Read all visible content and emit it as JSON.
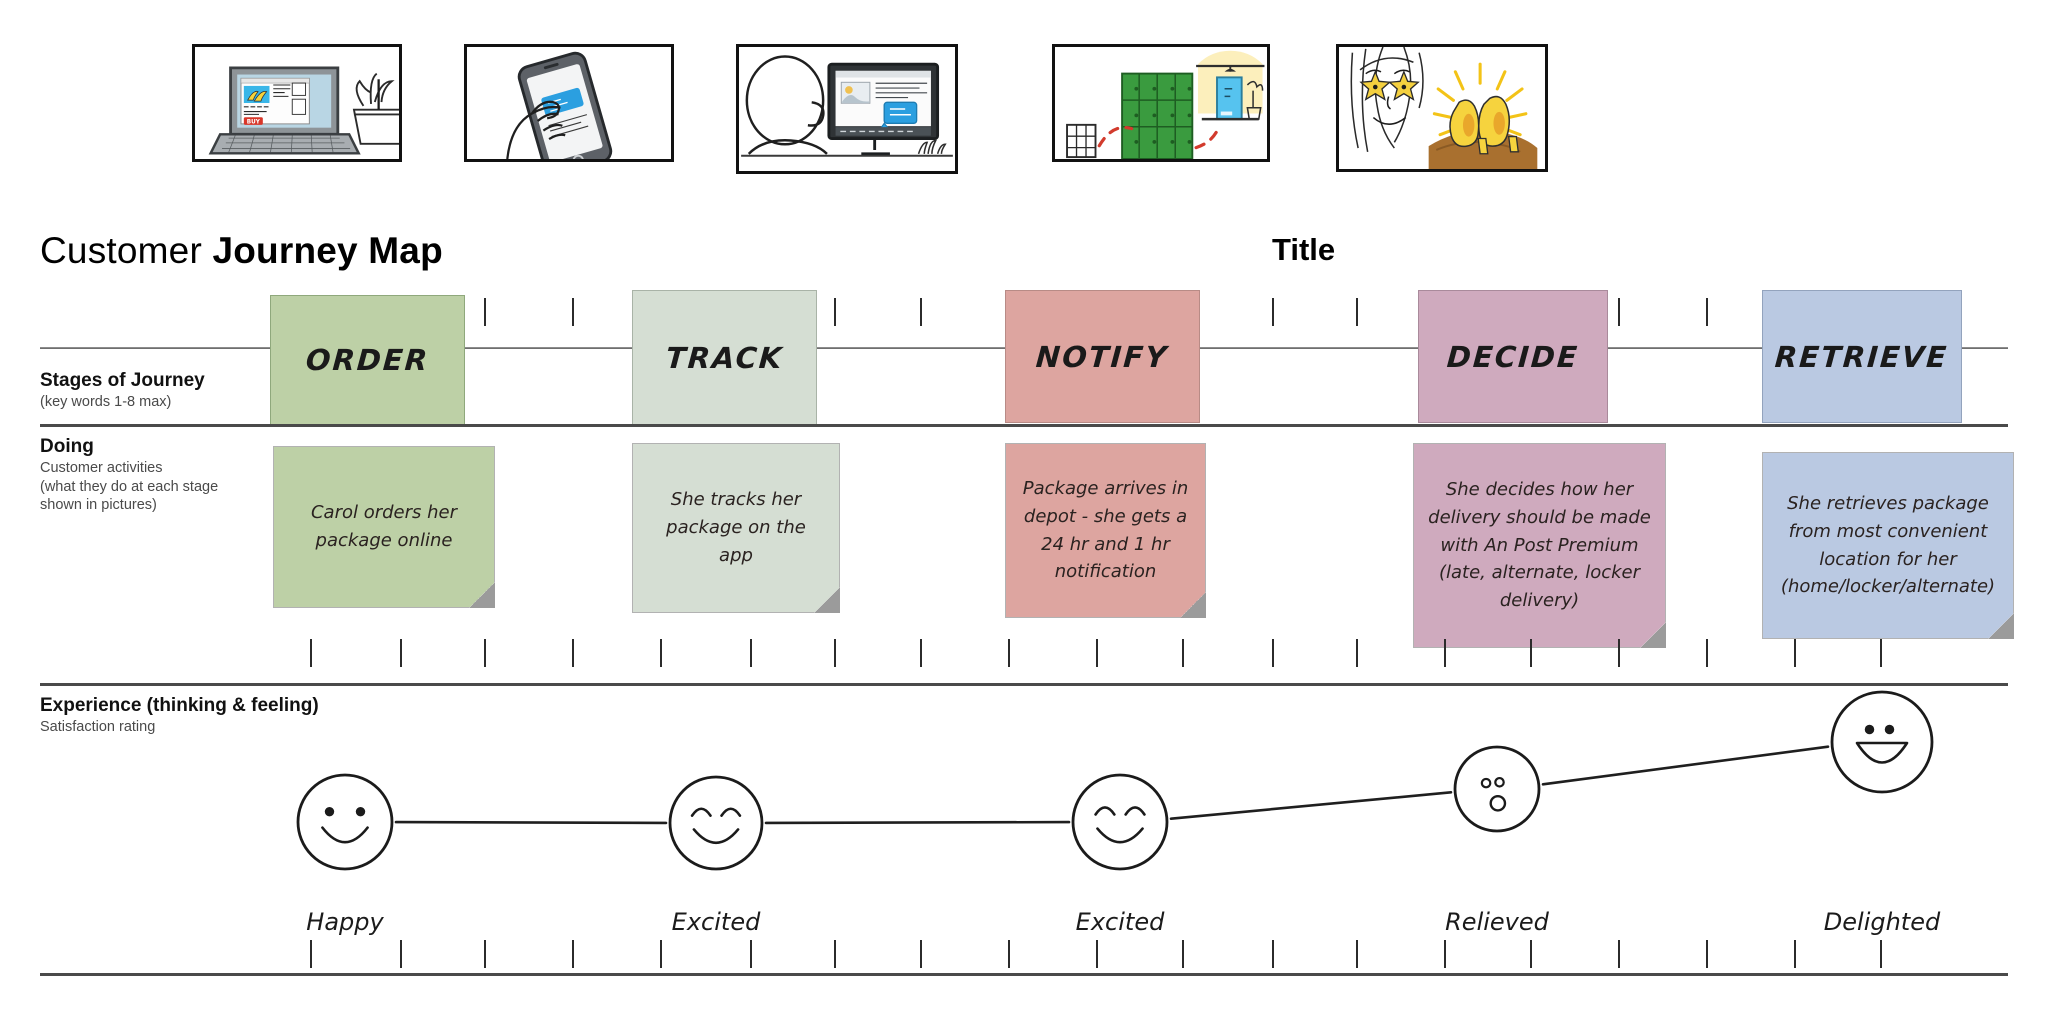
{
  "header": {
    "title_light": "Customer ",
    "title_bold": "Journey Map",
    "doc_title": "Title"
  },
  "rows": [
    {
      "key": "stages",
      "heading": "Stages of Journey",
      "sub": "(key words 1-8 max)"
    },
    {
      "key": "doing",
      "heading": "Doing",
      "sub": "Customer activities\n(what they do at each stage\n shown in pictures)"
    },
    {
      "key": "experience",
      "heading": "Experience (thinking & feeling)",
      "sub": "Satisfaction rating"
    }
  ],
  "stages": [
    {
      "label": "ORDER",
      "color": "#bdd0a6",
      "border": "#8fa87c"
    },
    {
      "label": "TRACK",
      "color": "#d5ded3",
      "border": "#a9b3a7"
    },
    {
      "label": "NOTIFY",
      "color": "#dda5a0",
      "border": "#b88b86"
    },
    {
      "label": "DECIDE",
      "color": "#cfaabe",
      "border": "#a98a9b"
    },
    {
      "label": "RETRIEVE",
      "color": "#bac9e2",
      "border": "#93a3bd"
    }
  ],
  "doing": [
    {
      "text": "Carol orders her\npackage online",
      "color": "#bdd0a6"
    },
    {
      "text": "She tracks her\npackage on the\napp",
      "color": "#d5ded3"
    },
    {
      "text": "Package arrives in\ndepot -  she gets a\n24 hr and 1 hr\nnotification",
      "color": "#dda5a0"
    },
    {
      "text": "She decides how her\ndelivery should be made\nwith An Post Premium\n(late, alternate, locker\ndelivery)",
      "color": "#cfaabe"
    },
    {
      "text": "She retrieves package\nfrom most convenient\nlocation for her\n(home/locker/alternate)",
      "color": "#bac9e2"
    }
  ],
  "experience": {
    "points": [
      {
        "label": "Happy",
        "face": "smile-face-icon",
        "rating": 3
      },
      {
        "label": "Excited",
        "face": "arc-eyes-face-icon",
        "rating": 3
      },
      {
        "label": "Excited",
        "face": "arc-eyes-face-icon",
        "rating": 3
      },
      {
        "label": "Relieved",
        "face": "oh-mouth-face-icon",
        "rating": 4
      },
      {
        "label": "Delighted",
        "face": "grin-face-icon",
        "rating": 5
      }
    ]
  },
  "illustrations": [
    {
      "name": "laptop-shopping-illustration",
      "alt": "Laptop showing online shop with BUY button and plant"
    },
    {
      "name": "phone-tracking-illustration",
      "alt": "Hand holding phone with tracking app"
    },
    {
      "name": "desktop-notification-illustration",
      "alt": "Person at desktop computer receiving notification"
    },
    {
      "name": "locker-delivery-illustration",
      "alt": "Parcel lockers and home door delivery route"
    },
    {
      "name": "delighted-customer-illustration",
      "alt": "Woman with star eyes and yellow shoes"
    }
  ],
  "chart_data": {
    "type": "line",
    "title": "Experience (thinking & feeling)",
    "ylabel": "Satisfaction rating",
    "categories": [
      "ORDER",
      "TRACK",
      "NOTIFY",
      "DECIDE",
      "RETRIEVE"
    ],
    "point_labels": [
      "Happy",
      "Excited",
      "Excited",
      "Relieved",
      "Delighted"
    ],
    "values": [
      3,
      3,
      3,
      4,
      5
    ],
    "ylim": [
      1,
      5
    ],
    "grid": false,
    "legend": "none"
  }
}
